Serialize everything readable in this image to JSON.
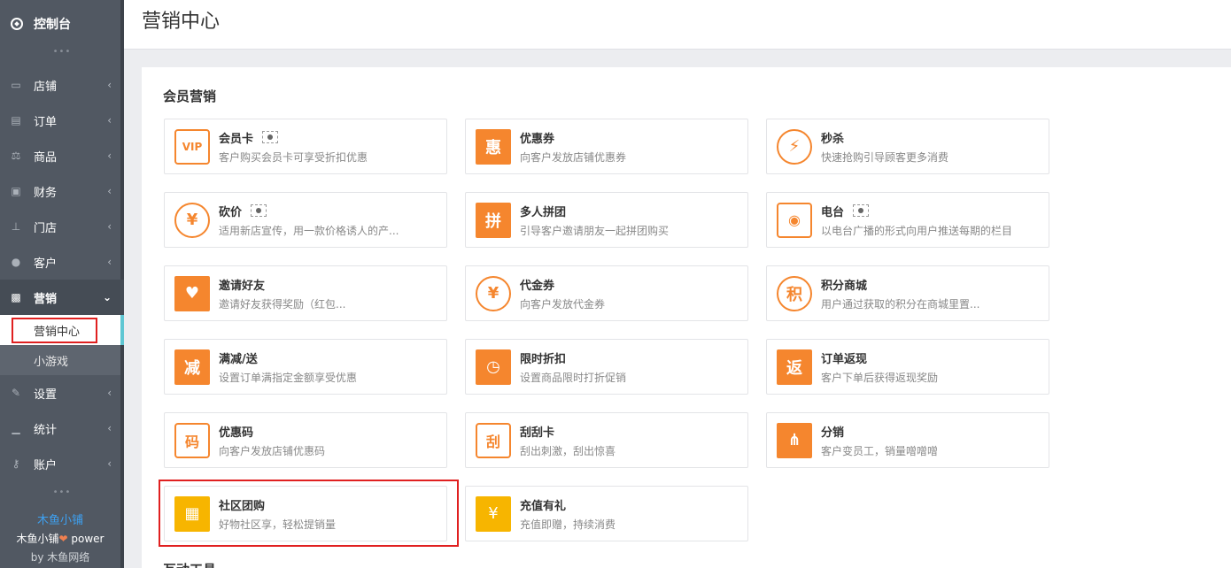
{
  "sidebar": {
    "top": {
      "label": "控制台",
      "icon": "dashboard-icon"
    },
    "items": [
      {
        "label": "店铺",
        "icon": "store-icon",
        "glyph": "▭"
      },
      {
        "label": "订单",
        "icon": "order-icon",
        "glyph": "▤"
      },
      {
        "label": "商品",
        "icon": "scale-icon",
        "glyph": "⚖"
      },
      {
        "label": "财务",
        "icon": "money-icon",
        "glyph": "▣"
      },
      {
        "label": "门店",
        "icon": "sitemap-icon",
        "glyph": "⊥"
      },
      {
        "label": "客户",
        "icon": "users-icon",
        "glyph": "●"
      },
      {
        "label": "营销",
        "icon": "gift-icon",
        "glyph": "▩"
      }
    ],
    "sub_items": [
      "营销中心",
      "小游戏"
    ],
    "items_after": [
      {
        "label": "设置",
        "icon": "wrench-icon",
        "glyph": "✎"
      },
      {
        "label": "统计",
        "icon": "signal-icon",
        "glyph": "▁"
      },
      {
        "label": "账户",
        "icon": "key-icon",
        "glyph": "⚷"
      }
    ],
    "footer": {
      "brand": "木鱼小铺",
      "power_prefix": "木鱼小铺",
      "power_suffix": " power",
      "by": "by 木鱼网络"
    }
  },
  "header": {
    "title": "营销中心"
  },
  "sections": [
    {
      "title": "会员营销"
    },
    {
      "title": "互动工具"
    }
  ],
  "cards": [
    {
      "name": "会员卡",
      "desc": "客户购买会员卡可享受折扣优惠",
      "glyph": "VIP",
      "icon": "vip-icon",
      "style": "icon-outline",
      "eye": true
    },
    {
      "name": "优惠券",
      "desc": "向客户发放店铺优惠券",
      "glyph": "惠",
      "icon": "coupon-icon",
      "style": "icon-sq",
      "eye": false
    },
    {
      "name": "秒杀",
      "desc": "快速抢购引导顾客更多消费",
      "glyph": "⚡",
      "icon": "lightning-icon",
      "style": "icon-circle",
      "eye": false
    },
    {
      "name": "砍价",
      "desc": "适用新店宣传，用一款价格诱人的产...",
      "glyph": "¥",
      "icon": "bargain-icon",
      "style": "icon-circle",
      "eye": true
    },
    {
      "name": "多人拼团",
      "desc": "引导客户邀请朋友一起拼团购买",
      "glyph": "拼",
      "icon": "group-buy-icon",
      "style": "icon-sq",
      "eye": false
    },
    {
      "name": "电台",
      "desc": "以电台广播的形式向用户推送每期的栏目",
      "glyph": "◉",
      "icon": "radio-icon",
      "style": "icon-outline",
      "eye": true
    },
    {
      "name": "邀请好友",
      "desc": "邀请好友获得奖励（红包...",
      "glyph": "♥",
      "icon": "invite-icon",
      "style": "icon-sq",
      "eye": false
    },
    {
      "name": "代金券",
      "desc": "向客户发放代金券",
      "glyph": "¥",
      "icon": "voucher-icon",
      "style": "icon-circle",
      "eye": false
    },
    {
      "name": "积分商城",
      "desc": "用户通过获取的积分在商城里置...",
      "glyph": "积",
      "icon": "points-icon",
      "style": "icon-circle",
      "eye": false
    },
    {
      "name": "满减/送",
      "desc": "设置订单满指定金额享受优惠",
      "glyph": "减",
      "icon": "discount-icon",
      "style": "icon-sq",
      "eye": false
    },
    {
      "name": "限时折扣",
      "desc": "设置商品限时打折促销",
      "glyph": "◷",
      "icon": "clock-icon",
      "style": "icon-sq",
      "eye": false
    },
    {
      "name": "订单返现",
      "desc": "客户下单后获得返现奖励",
      "glyph": "返",
      "icon": "cashback-icon",
      "style": "icon-sq",
      "eye": false
    },
    {
      "name": "优惠码",
      "desc": "向客户发放店铺优惠码",
      "glyph": "码",
      "icon": "promo-code-icon",
      "style": "icon-outline",
      "eye": false
    },
    {
      "name": "刮刮卡",
      "desc": "刮出刺激，刮出惊喜",
      "glyph": "刮",
      "icon": "scratch-card-icon",
      "style": "icon-outline",
      "eye": false
    },
    {
      "name": "分销",
      "desc": "客户变员工，销量噌噌噌",
      "glyph": "⋔",
      "icon": "distribution-icon",
      "style": "icon-sq",
      "eye": false
    },
    {
      "name": "社区团购",
      "desc": "好物社区享，轻松提销量",
      "glyph": "▦",
      "icon": "building-icon",
      "style": "icon-yellow",
      "eye": false
    },
    {
      "name": "充值有礼",
      "desc": "充值即赠，持续消费",
      "glyph": "¥",
      "icon": "moneybag-icon",
      "style": "icon-yellow",
      "eye": false
    }
  ]
}
